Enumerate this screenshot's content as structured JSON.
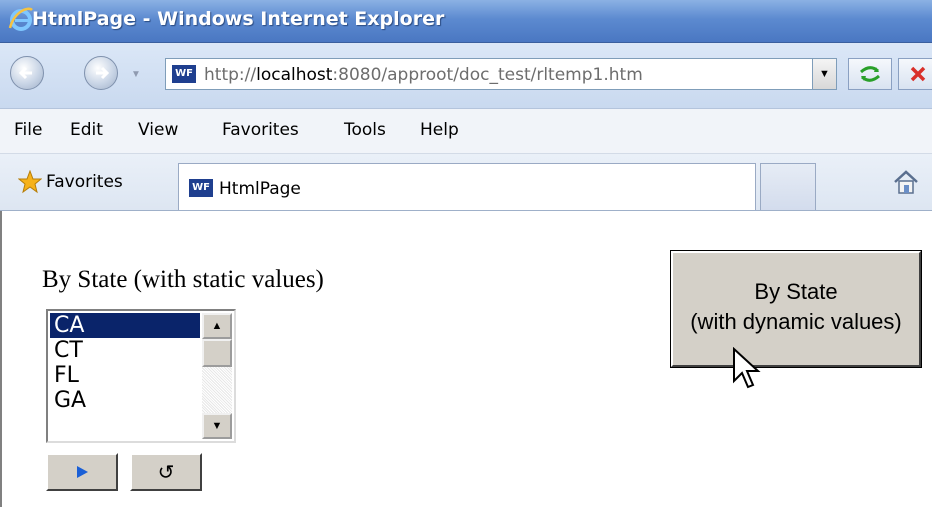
{
  "window": {
    "title": "HtmlPage - Windows Internet Explorer"
  },
  "address_bar": {
    "url_prefix": "http://",
    "url_host": "localhost",
    "url_rest": ":8080/approot/doc_test/rltemp1.htm",
    "site_icon_text": "WF"
  },
  "menu": {
    "items": [
      "File",
      "Edit",
      "View",
      "Favorites",
      "Tools",
      "Help"
    ]
  },
  "favorites_bar": {
    "favorites_label": "Favorites",
    "tab_icon_text": "WF",
    "tab_label": "HtmlPage"
  },
  "page": {
    "heading": "By State  (with static values)",
    "listbox": {
      "options": [
        "CA",
        "CT",
        "FL",
        "GA"
      ],
      "selected": "CA"
    },
    "reset_symbol": "↺",
    "dynamic_button": {
      "line1": "By State",
      "line2": "(with dynamic values)"
    }
  },
  "colors": {
    "titlebar": "#5c8ad0",
    "selection": "#0a246a",
    "button_face": "#d4d0c8",
    "run_arrow": "#1a5fd6"
  }
}
